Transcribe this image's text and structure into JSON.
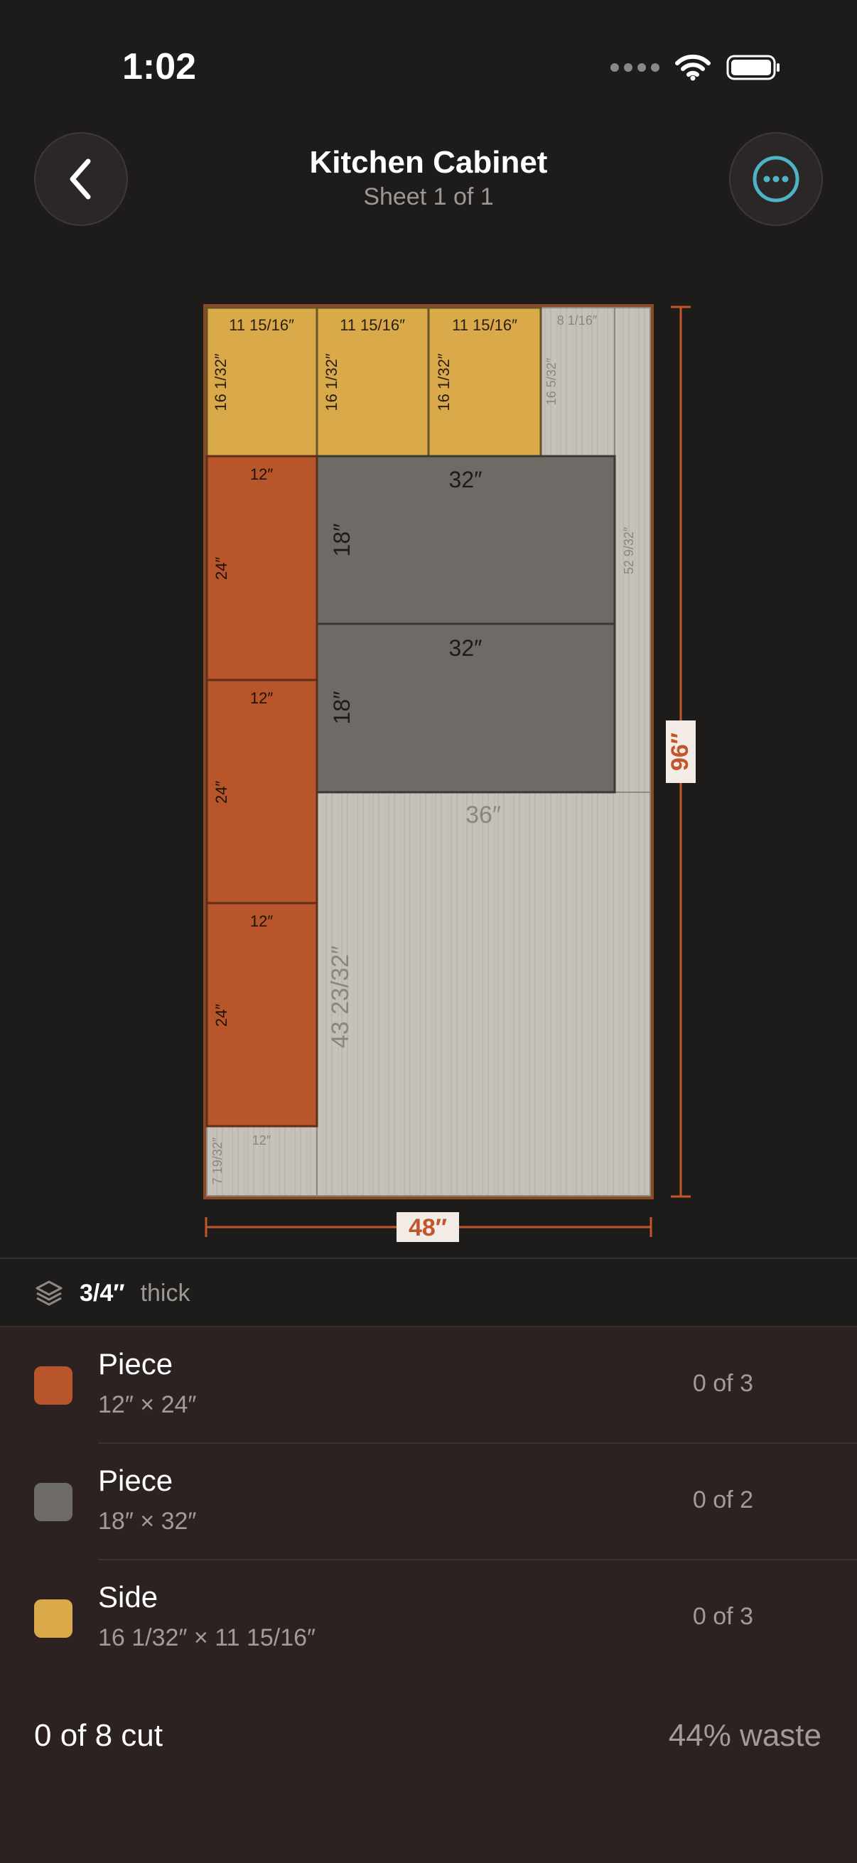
{
  "status_bar": {
    "time": "1:02"
  },
  "header": {
    "title": "Kitchen Cabinet",
    "subtitle": "Sheet 1 of 1"
  },
  "sheet": {
    "height_label": "96″",
    "width_label": "48″",
    "pieces": [
      {
        "w": "11 15/16″",
        "h": "16 1/32″",
        "kind": "side"
      },
      {
        "w": "11 15/16″",
        "h": "16 1/32″",
        "kind": "side"
      },
      {
        "w": "11 15/16″",
        "h": "16 1/32″",
        "kind": "side"
      },
      {
        "w": "32″",
        "h": "18″",
        "kind": "gray"
      },
      {
        "w": "32″",
        "h": "18″",
        "kind": "gray"
      },
      {
        "w": "12″",
        "h": "24″",
        "kind": "orange"
      },
      {
        "w": "12″",
        "h": "24″",
        "kind": "orange"
      },
      {
        "w": "12″",
        "h": "24″",
        "kind": "orange"
      }
    ],
    "offcuts": [
      {
        "w": "8 1/16″",
        "h": "16 5/32″"
      },
      {
        "h": "52 9/32″"
      },
      {
        "w": "36″",
        "h": "43 23/32″"
      },
      {
        "w": "12″",
        "h": "7 19/32″"
      }
    ]
  },
  "material": {
    "thickness": "3/4″",
    "label": "thick"
  },
  "pieces": [
    {
      "name": "Piece",
      "size": "12″ × 24″",
      "count": "0 of 3",
      "color": "#b9552a"
    },
    {
      "name": "Piece",
      "size": "18″ × 32″",
      "count": "0 of 2",
      "color": "#6e6b66"
    },
    {
      "name": "Side",
      "size": "16 1/32″ × 11 15/16″",
      "count": "0 of 3",
      "color": "#d9a94a"
    }
  ],
  "summary": {
    "cut": "0 of 8 cut",
    "waste": "44% waste"
  },
  "colors": {
    "orange": "#b9552a",
    "gray": "#6e6b66",
    "side": "#d9a94a",
    "offcut": "#c6c1bb",
    "accent": "#c0562a",
    "more_icon": "#4fb3c8"
  },
  "icons": {
    "back": "chevron-left-icon",
    "more": "ellipsis-circle-icon",
    "layers": "layers-icon",
    "wifi": "wifi-icon",
    "battery": "battery-icon",
    "signal": "signal-icon"
  }
}
